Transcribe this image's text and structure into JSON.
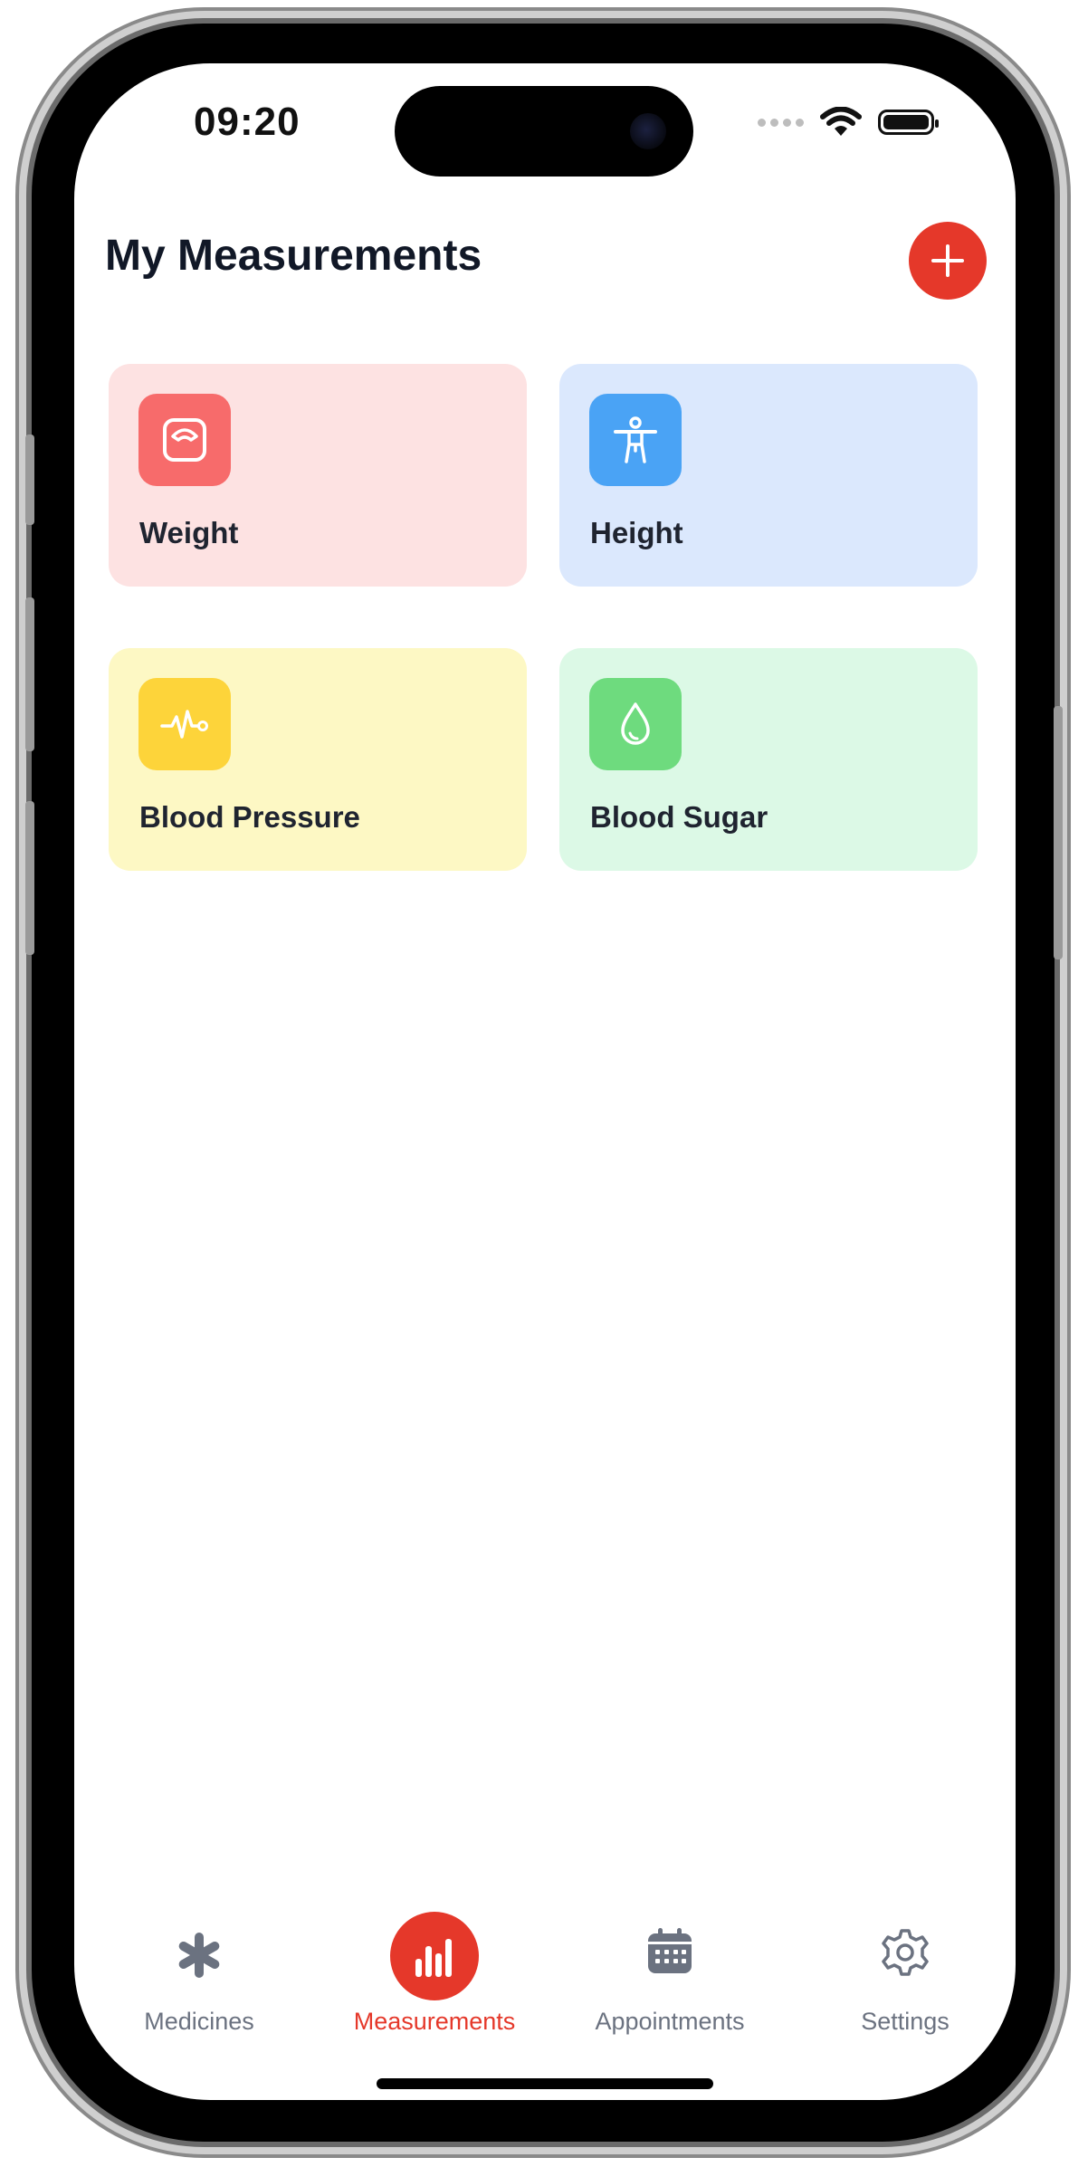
{
  "status_bar": {
    "time": "09:20"
  },
  "header": {
    "title": "My Measurements",
    "add_icon": "plus-icon",
    "accent_color": "#e5382a"
  },
  "cards": [
    {
      "label": "Weight",
      "icon": "scale-icon",
      "bg": "#fde2e2",
      "tile": "#f76b6b"
    },
    {
      "label": "Height",
      "icon": "person-icon",
      "bg": "#dbe8fd",
      "tile": "#4aa3f5"
    },
    {
      "label": "Blood Pressure",
      "icon": "heartbeat-icon",
      "bg": "#fdf8c4",
      "tile": "#fdd43a"
    },
    {
      "label": "Blood Sugar",
      "icon": "droplet-icon",
      "bg": "#dcf9e6",
      "tile": "#6edb7e"
    }
  ],
  "tabs": [
    {
      "label": "Medicines",
      "icon": "asterisk-icon",
      "active": false
    },
    {
      "label": "Measurements",
      "icon": "bar-chart-icon",
      "active": true
    },
    {
      "label": "Appointments",
      "icon": "calendar-icon",
      "active": false
    },
    {
      "label": "Settings",
      "icon": "gear-icon",
      "active": false
    }
  ]
}
